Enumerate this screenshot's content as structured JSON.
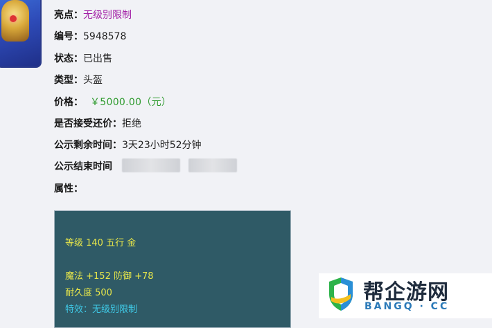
{
  "rows": [
    {
      "key": "亮点：",
      "value": "无级别限制",
      "style": "pink"
    },
    {
      "key": "编号：",
      "value": "5948578",
      "style": "plain"
    },
    {
      "key": "状态：",
      "value": "已出售",
      "style": "plain"
    },
    {
      "key": "类型：",
      "value": "头盔",
      "style": "plain"
    },
    {
      "key": "价格：",
      "value": "￥5000.00（元）",
      "style": "green"
    },
    {
      "key": "是否接受还价：",
      "value": "拒绝",
      "style": "plain"
    },
    {
      "key": "公示剩余时间：",
      "value": "3天23小时52分钟",
      "style": "plain"
    },
    {
      "key": "公示结束时间",
      "value": "",
      "style": "plain"
    },
    {
      "key": "属性：",
      "value": "",
      "style": "plain"
    }
  ],
  "attributes": {
    "line1": "等级 140 五行 金",
    "line2": "魔法 +152 防御 +78",
    "line3": "耐久度 500",
    "line4": "特效：无级别限制"
  },
  "watermark": {
    "cn": "帮企游网",
    "en": "BANGQ · CC"
  },
  "colors": {
    "pink": "#a21fa6",
    "green": "#2f9b2f",
    "attr_bg": "#2f5a66",
    "attr_yellow": "#e7e64a",
    "attr_cyan": "#3fc9e6"
  }
}
